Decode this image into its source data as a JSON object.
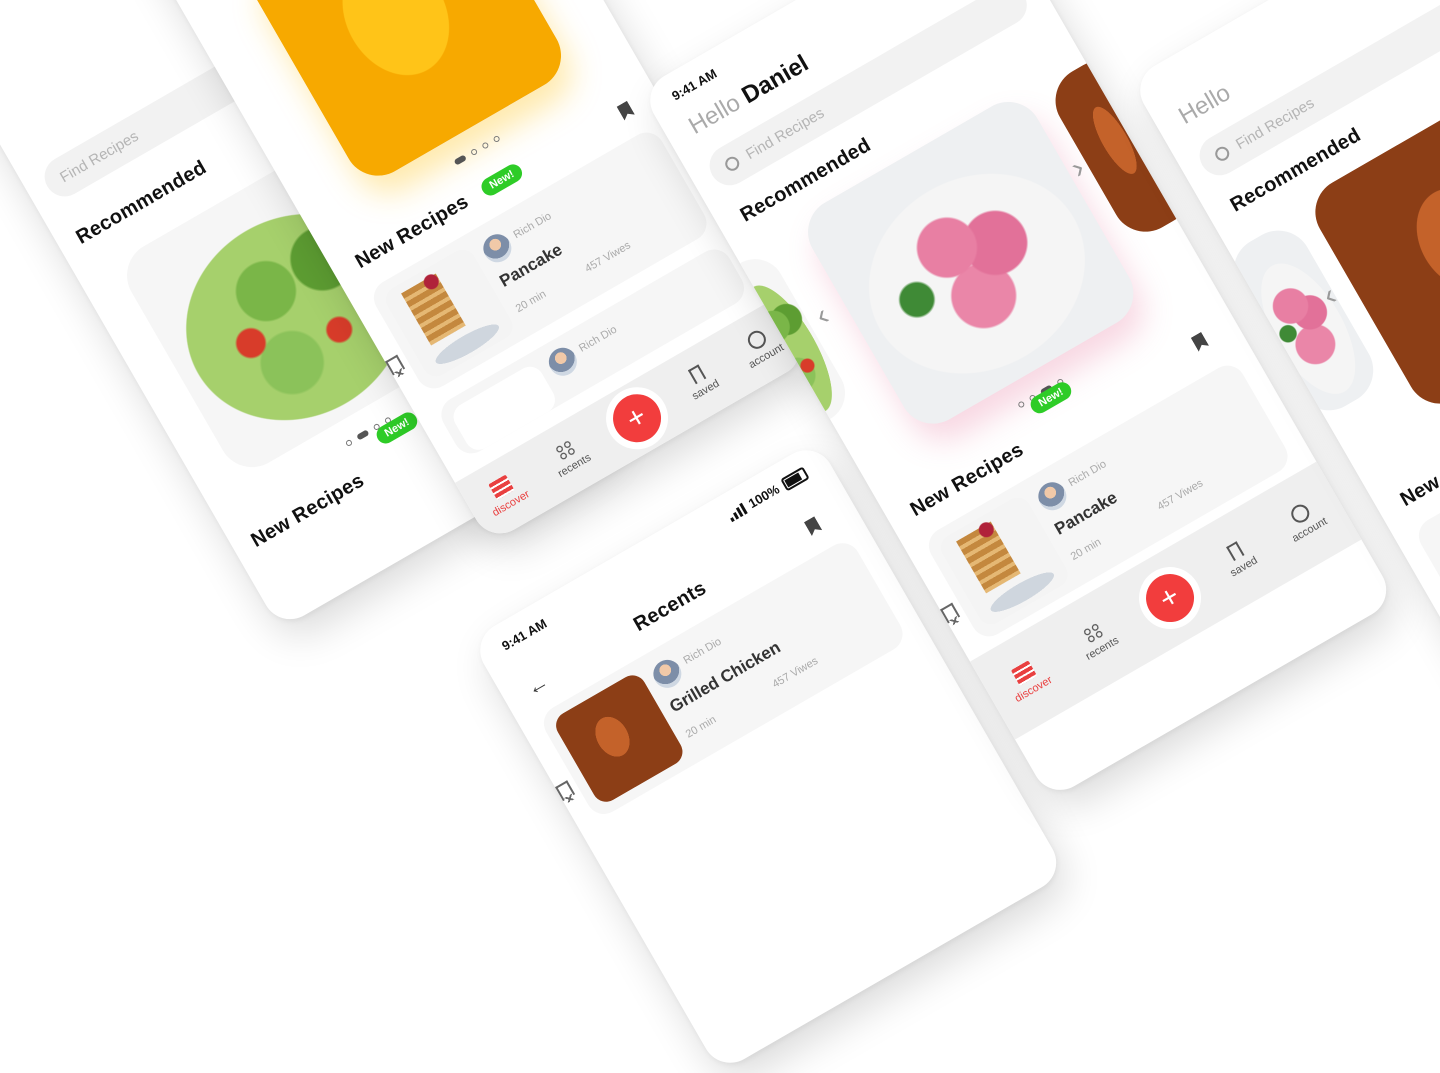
{
  "status": {
    "time": "9:41 AM",
    "battery": "100%"
  },
  "greeting": {
    "hello": "Hello",
    "name": "Daniel"
  },
  "search": {
    "placeholder": "Find Recipes"
  },
  "sections": {
    "recommended": "Recommended",
    "new_recipes": "New Recipes",
    "badge": "New!",
    "recents": "Recents"
  },
  "recipes": [
    {
      "author": "Rich Dio",
      "name": "Pancake",
      "time": "20 min",
      "views": "457 Viwes"
    },
    {
      "author": "Rich Dio",
      "name": "Grilled Chicken",
      "time": "20 min",
      "views": "457 Viwes"
    }
  ],
  "tabs": {
    "discover": "discover",
    "recents": "recents",
    "add": "+",
    "saved": "saved",
    "account": "account"
  },
  "colors": {
    "accent": "#f23d3d",
    "badge": "#2ecc27"
  }
}
